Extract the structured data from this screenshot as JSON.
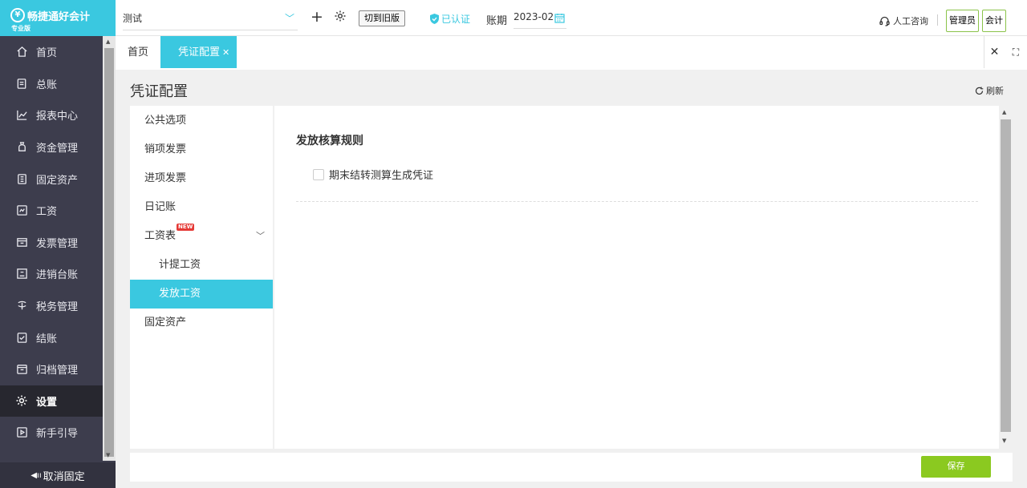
{
  "app": {
    "name": "畅捷通好会计",
    "edition": "专业版"
  },
  "sidebar": {
    "items": [
      {
        "label": "首页",
        "icon": "home-icon"
      },
      {
        "label": "总账",
        "icon": "ledger-icon"
      },
      {
        "label": "报表中心",
        "icon": "chart-icon"
      },
      {
        "label": "资金管理",
        "icon": "money-bag-icon"
      },
      {
        "label": "固定资产",
        "icon": "asset-icon"
      },
      {
        "label": "工资",
        "icon": "salary-icon"
      },
      {
        "label": "发票管理",
        "icon": "invoice-icon"
      },
      {
        "label": "进销台账",
        "icon": "inventory-icon"
      },
      {
        "label": "税务管理",
        "icon": "tax-icon"
      },
      {
        "label": "结账",
        "icon": "closing-icon"
      },
      {
        "label": "归档管理",
        "icon": "archive-icon"
      },
      {
        "label": "设置",
        "icon": "gear-icon"
      },
      {
        "label": "新手引导",
        "icon": "guide-icon"
      }
    ],
    "active_index": 11,
    "footer_label": "取消固定"
  },
  "topbar": {
    "company": "测试",
    "old_version": "切到旧版",
    "certified": "已认证",
    "period_label": "账期",
    "period_value": "2023-02",
    "support": "人工咨询",
    "role_admin": "管理员",
    "role_accountant": "会计"
  },
  "tabs": {
    "home": "首页",
    "active": "凭证配置"
  },
  "page": {
    "title": "凭证配置",
    "refresh": "刷新"
  },
  "left_menu": {
    "items": [
      {
        "label": "公共选项"
      },
      {
        "label": "销项发票"
      },
      {
        "label": "进项发票"
      },
      {
        "label": "日记账"
      },
      {
        "label": "工资表",
        "badge": "NEW",
        "expandable": true
      },
      {
        "label": "计提工资",
        "sub": true
      },
      {
        "label": "发放工资",
        "sub": true
      },
      {
        "label": "固定资产"
      }
    ],
    "active_index": 6
  },
  "main": {
    "section_title": "发放核算规则",
    "checkbox_label": "期末结转测算生成凭证",
    "checkbox_checked": false
  },
  "footer": {
    "save": "保存"
  },
  "colors": {
    "accent": "#3ac8e0",
    "sidebar": "#3d3d4d",
    "save": "#8bc920",
    "role_border": "#8bc34a"
  }
}
